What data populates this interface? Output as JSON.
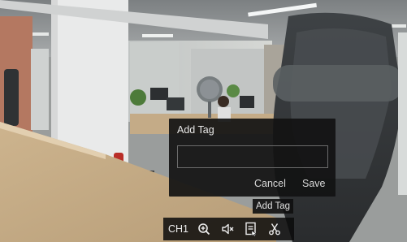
{
  "dialog": {
    "title": "Add Tag",
    "input_value": "",
    "cancel_label": "Cancel",
    "save_label": "Save"
  },
  "tooltip": {
    "text": "Add Tag"
  },
  "toolbar": {
    "channel_label": "CH1",
    "buttons": [
      {
        "icon": "zoom-in-icon"
      },
      {
        "icon": "mute-icon"
      },
      {
        "icon": "add-tag-icon"
      },
      {
        "icon": "scissors-icon"
      }
    ]
  }
}
